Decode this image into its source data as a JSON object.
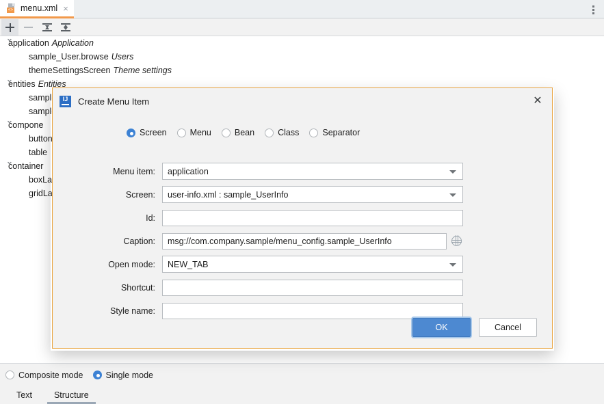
{
  "editor": {
    "tab": {
      "label": "menu.xml",
      "icon": "xml-file-icon",
      "close": "×"
    },
    "options_icon": "kebab-menu-icon"
  },
  "toolbar": {
    "buttons": [
      {
        "name": "add-button",
        "icon": "plus-icon",
        "selected": true
      },
      {
        "name": "remove-button",
        "icon": "minus-icon",
        "selected": false
      },
      {
        "name": "expand-all-button",
        "icon": "expand-all-icon",
        "selected": false
      },
      {
        "name": "collapse-all-button",
        "icon": "collapse-all-icon",
        "selected": false
      }
    ]
  },
  "tree": {
    "nodes": [
      {
        "indent": 0,
        "expanded": true,
        "name": "application",
        "caption": "Application"
      },
      {
        "indent": 1,
        "expanded": null,
        "name": "sample_User.browse",
        "caption": "Users"
      },
      {
        "indent": 1,
        "expanded": null,
        "name": "themeSettingsScreen",
        "caption": "Theme settings"
      },
      {
        "indent": 0,
        "expanded": true,
        "name": "entities",
        "caption": "Entities"
      },
      {
        "indent": 1,
        "expanded": null,
        "name": "sample",
        "caption": ""
      },
      {
        "indent": 1,
        "expanded": null,
        "name": "sample",
        "caption": ""
      },
      {
        "indent": 0,
        "expanded": true,
        "name": "compone",
        "caption": ""
      },
      {
        "indent": 1,
        "expanded": null,
        "name": "button",
        "caption": ""
      },
      {
        "indent": 1,
        "expanded": null,
        "name": "table",
        "caption": ""
      },
      {
        "indent": 0,
        "expanded": true,
        "name": "container",
        "caption": ""
      },
      {
        "indent": 1,
        "expanded": null,
        "name": "boxLa",
        "caption": ""
      },
      {
        "indent": 1,
        "expanded": null,
        "name": "gridLa",
        "caption": ""
      }
    ]
  },
  "bottom": {
    "modes": [
      {
        "label": "Composite mode",
        "selected": false
      },
      {
        "label": "Single mode",
        "selected": true
      }
    ],
    "tabs": [
      {
        "label": "Text",
        "active": false
      },
      {
        "label": "Structure",
        "active": true
      }
    ]
  },
  "dialog": {
    "title": "Create Menu Item",
    "icon": "intellij-idea-icon",
    "close_label": "✕",
    "type_options": [
      {
        "label": "Screen",
        "selected": true
      },
      {
        "label": "Menu",
        "selected": false
      },
      {
        "label": "Bean",
        "selected": false
      },
      {
        "label": "Class",
        "selected": false
      },
      {
        "label": "Separator",
        "selected": false
      }
    ],
    "fields": {
      "menu_item": {
        "label": "Menu item:",
        "value": "application",
        "placeholder": ""
      },
      "screen": {
        "label": "Screen:",
        "value": "user-info.xml : sample_UserInfo",
        "placeholder": ""
      },
      "id": {
        "label": "Id:",
        "value": "",
        "placeholder": ""
      },
      "caption": {
        "label": "Caption:",
        "value": "msg://com.company.sample/menu_config.sample_UserInfo",
        "placeholder": ""
      },
      "open_mode": {
        "label": "Open mode:",
        "value": "NEW_TAB",
        "placeholder": ""
      },
      "shortcut": {
        "label": "Shortcut:",
        "value": "",
        "placeholder": ""
      },
      "style_name": {
        "label": "Style name:",
        "value": "",
        "placeholder": ""
      }
    },
    "caption_localize_icon": "globe-icon",
    "buttons": {
      "ok": "OK",
      "cancel": "Cancel"
    }
  },
  "colors": {
    "accent": "#4d89d1",
    "dialog_border": "#e8a33d",
    "tab_underline": "#f2994a",
    "panel_bg": "#f2f2f2"
  }
}
